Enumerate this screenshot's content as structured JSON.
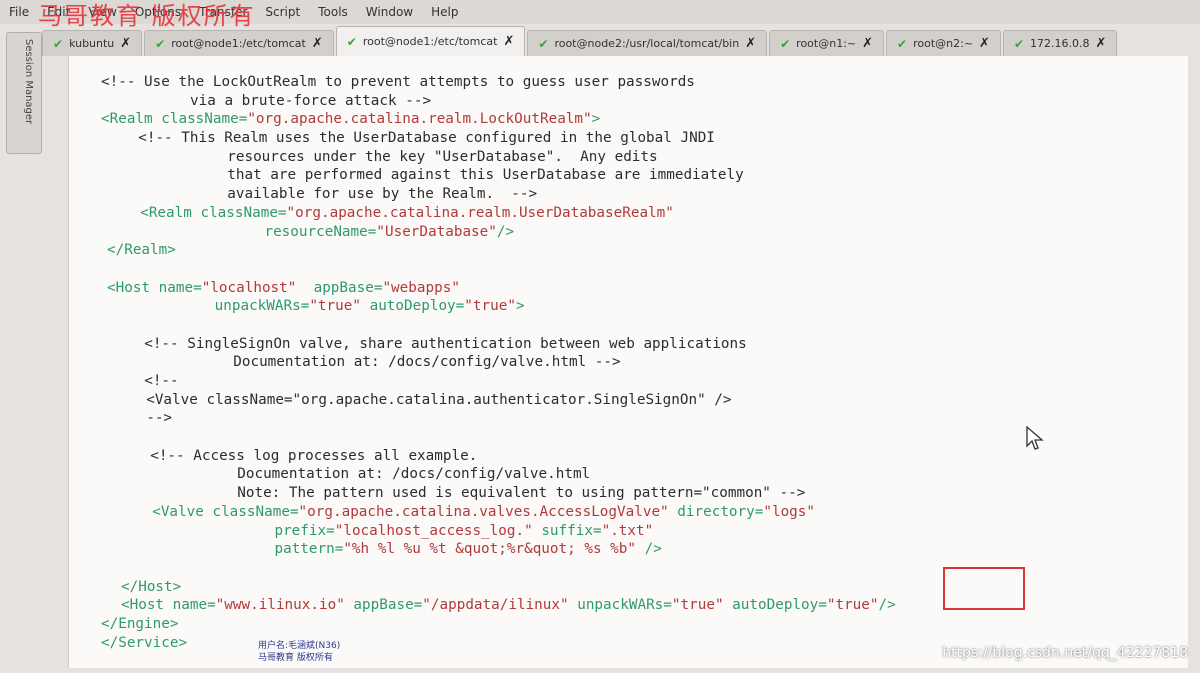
{
  "watermark_top": "马哥教育 版权所有",
  "menu": [
    "File",
    "Edit",
    "View",
    "Options",
    "Transfer",
    "Script",
    "Tools",
    "Window",
    "Help"
  ],
  "sidebar_label": "Session Manager",
  "tabs": [
    {
      "label": "kubuntu"
    },
    {
      "label": "root@node1:/etc/tomcat"
    },
    {
      "label": "root@node1:/etc/tomcat"
    },
    {
      "label": "root@node2:/usr/local/tomcat/bin"
    },
    {
      "label": "root@n1:~"
    },
    {
      "label": "root@n2:~"
    },
    {
      "label": "172.16.0.8"
    }
  ],
  "active_tab_index": 2,
  "code_lines": [
    {
      "indent": 0,
      "segments": [
        {
          "t": "cmt",
          "v": "<!-- Use the LockOutRealm to prevent attempts to guess user passwords"
        }
      ]
    },
    {
      "indent": 0,
      "segments": [
        {
          "t": "cmt",
          "v": "     via a brute-force attack -->"
        }
      ]
    },
    {
      "indent": 0,
      "segments": [
        {
          "t": "tag",
          "v": "<Realm className="
        },
        {
          "t": "val",
          "v": "\"org.apache.catalina.realm.LockOutRealm\""
        },
        {
          "t": "tag",
          "v": ">"
        }
      ]
    },
    {
      "indent": 0,
      "segments": [
        {
          "t": "cmt",
          "v": "  <!-- This Realm uses the UserDatabase configured in the global JNDI"
        }
      ]
    },
    {
      "indent": 0,
      "segments": [
        {
          "t": "cmt",
          "v": "       resources under the key \"UserDatabase\".  Any edits"
        }
      ]
    },
    {
      "indent": 0,
      "segments": [
        {
          "t": "cmt",
          "v": "       that are performed against this UserDatabase are immediately"
        }
      ]
    },
    {
      "indent": 0,
      "segments": [
        {
          "t": "cmt",
          "v": "       available for use by the Realm.  -->"
        }
      ]
    },
    {
      "indent": 0,
      "segments": [
        {
          "t": "tag",
          "v": "  <Realm className="
        },
        {
          "t": "val",
          "v": "\"org.apache.catalina.realm.UserDatabaseRealm\""
        }
      ]
    },
    {
      "indent": 0,
      "segments": [
        {
          "t": "tag",
          "v": "         resourceName="
        },
        {
          "t": "val",
          "v": "\"UserDatabase\""
        },
        {
          "t": "tag",
          "v": "/>"
        }
      ]
    },
    {
      "indent": 0,
      "segments": [
        {
          "t": "tag",
          "v": "</Realm>"
        }
      ]
    },
    {
      "indent": 0,
      "segments": []
    },
    {
      "indent": 0,
      "segments": [
        {
          "t": "tag",
          "v": "<Host name="
        },
        {
          "t": "val",
          "v": "\"localhost\""
        },
        {
          "t": "tag",
          "v": "  appBase="
        },
        {
          "t": "val",
          "v": "\"webapps\""
        }
      ]
    },
    {
      "indent": 0,
      "segments": [
        {
          "t": "tag",
          "v": "      unpackWARs="
        },
        {
          "t": "val",
          "v": "\"true\""
        },
        {
          "t": "tag",
          "v": " autoDeploy="
        },
        {
          "t": "val",
          "v": "\"true\""
        },
        {
          "t": "tag",
          "v": ">"
        }
      ]
    },
    {
      "indent": 0,
      "segments": []
    },
    {
      "indent": 0,
      "segments": [
        {
          "t": "cmt",
          "v": "  <!-- SingleSignOn valve, share authentication between web applications"
        }
      ]
    },
    {
      "indent": 0,
      "segments": [
        {
          "t": "cmt",
          "v": "       Documentation at: /docs/config/valve.html -->"
        }
      ]
    },
    {
      "indent": 0,
      "segments": [
        {
          "t": "cmt",
          "v": "  <!--"
        }
      ]
    },
    {
      "indent": 0,
      "segments": [
        {
          "t": "cmt",
          "v": "  <Valve className=\"org.apache.catalina.authenticator.SingleSignOn\" />"
        }
      ]
    },
    {
      "indent": 0,
      "segments": [
        {
          "t": "cmt",
          "v": "  -->"
        }
      ]
    },
    {
      "indent": 0,
      "segments": []
    },
    {
      "indent": 0,
      "segments": [
        {
          "t": "cmt",
          "v": "  <!-- Access log processes all example."
        }
      ]
    },
    {
      "indent": 0,
      "segments": [
        {
          "t": "cmt",
          "v": "       Documentation at: /docs/config/valve.html"
        }
      ]
    },
    {
      "indent": 0,
      "segments": [
        {
          "t": "cmt",
          "v": "       Note: The pattern used is equivalent to using pattern=\"common\" -->"
        }
      ]
    },
    {
      "indent": 0,
      "segments": [
        {
          "t": "tag",
          "v": "  <Valve className="
        },
        {
          "t": "val",
          "v": "\"org.apache.catalina.valves.AccessLogValve\""
        },
        {
          "t": "tag",
          "v": " directory="
        },
        {
          "t": "val",
          "v": "\"logs\""
        }
      ]
    },
    {
      "indent": 0,
      "segments": [
        {
          "t": "tag",
          "v": "         prefix="
        },
        {
          "t": "val",
          "v": "\"localhost_access_log.\""
        },
        {
          "t": "tag",
          "v": " suffix="
        },
        {
          "t": "val",
          "v": "\".txt\""
        }
      ]
    },
    {
      "indent": 0,
      "segments": [
        {
          "t": "tag",
          "v": "         pattern="
        },
        {
          "t": "val",
          "v": "\"%h %l %u %t &quot;%r&quot; %s %b\""
        },
        {
          "t": "tag",
          "v": " />"
        }
      ]
    },
    {
      "indent": 0,
      "segments": []
    },
    {
      "indent": 0,
      "segments": [
        {
          "t": "tag",
          "v": "</Host>"
        }
      ]
    },
    {
      "indent": 0,
      "segments": [
        {
          "t": "tag",
          "v": "<Host name="
        },
        {
          "t": "val",
          "v": "\"www.ilinux.io\""
        },
        {
          "t": "tag",
          "v": " appBase="
        },
        {
          "t": "val",
          "v": "\"/appdata/ilinux\""
        },
        {
          "t": "tag",
          "v": " unpackWARs="
        },
        {
          "t": "val",
          "v": "\"true\""
        },
        {
          "t": "tag",
          "v": " autoDeploy="
        },
        {
          "t": "val",
          "v": "\"true\""
        },
        {
          "t": "tag",
          "v": "/>"
        }
      ]
    },
    {
      "indent": 0,
      "segments": [
        {
          "t": "tag",
          "v": "</Engine>"
        }
      ]
    },
    {
      "indent": 0,
      "segments": [
        {
          "t": "tag",
          "v": "</Service>"
        }
      ]
    }
  ],
  "footer_watermark_1": "用户名:毛涵斌(N36)",
  "footer_watermark_2": "马哥教育 版权所有",
  "url_watermark": "https://blog.csdn.net/qq_42227818"
}
